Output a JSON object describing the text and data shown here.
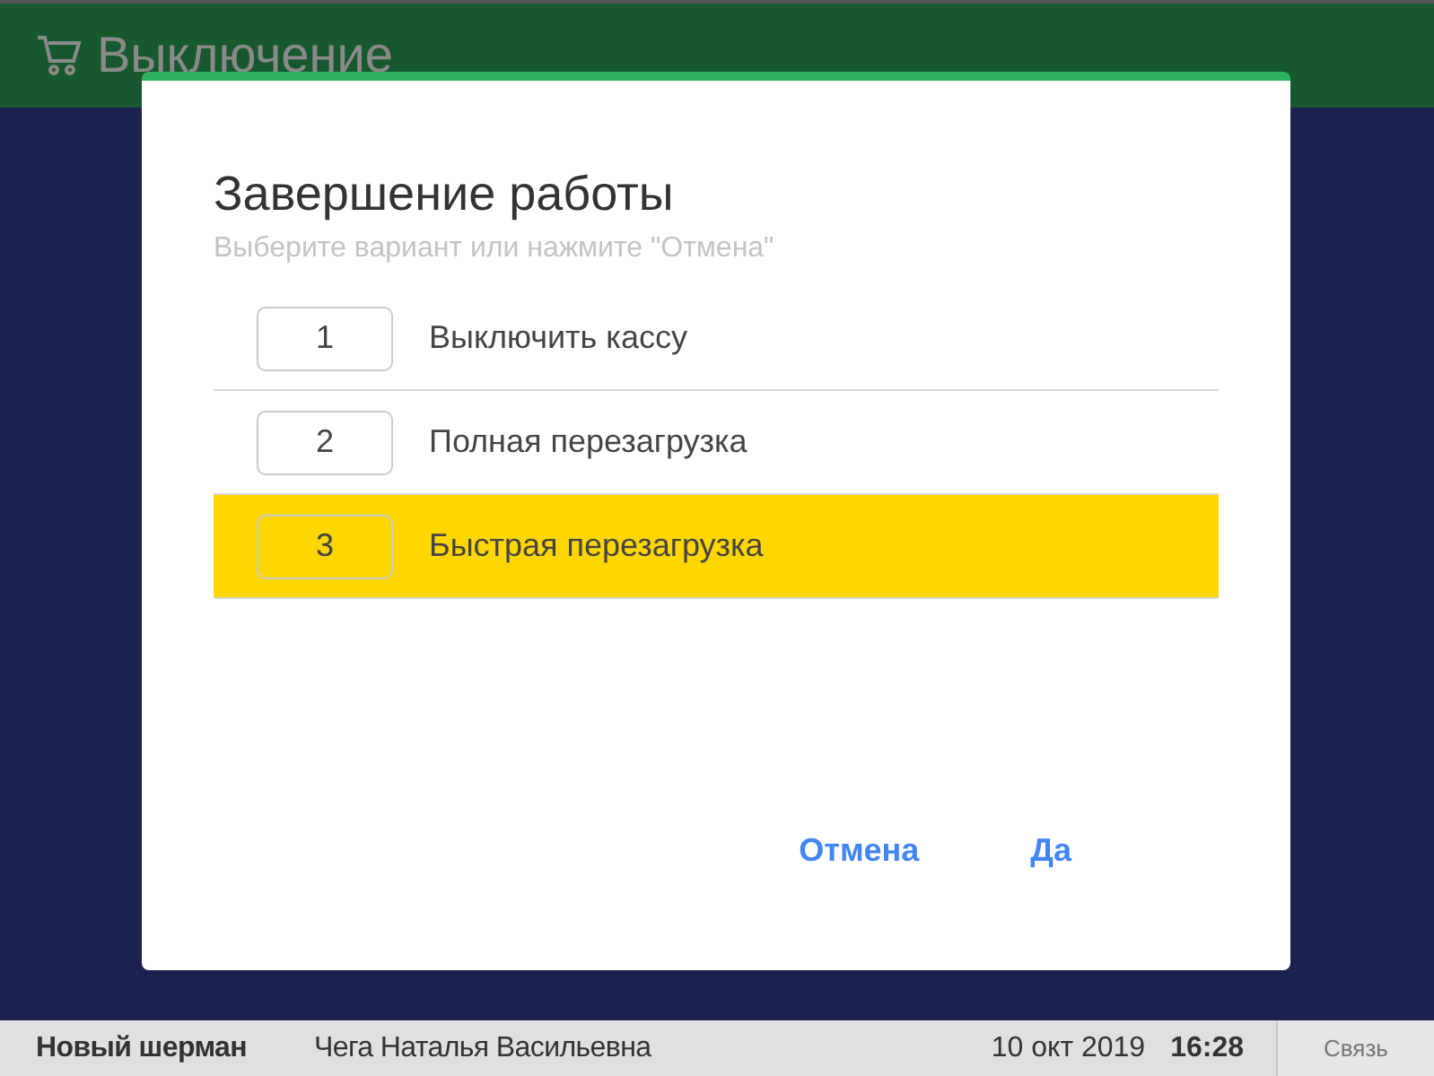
{
  "header": {
    "title": "Выключение"
  },
  "dialog": {
    "title": "Завершение работы",
    "subtitle": "Выберите вариант или нажмите \"Отмена\"",
    "options": [
      {
        "key": "1",
        "label": "Выключить кассу",
        "selected": false
      },
      {
        "key": "2",
        "label": "Полная перезагрузка",
        "selected": false
      },
      {
        "key": "3",
        "label": "Быстрая перезагрузка",
        "selected": true
      }
    ],
    "buttons": [
      "Отмена",
      "Да"
    ]
  },
  "status_bar": {
    "shop": "Новый шерман",
    "cashier": "Чега Наталья Васильевна",
    "date": "10 окт 2019",
    "time": "16:28",
    "connection": "Связь"
  }
}
